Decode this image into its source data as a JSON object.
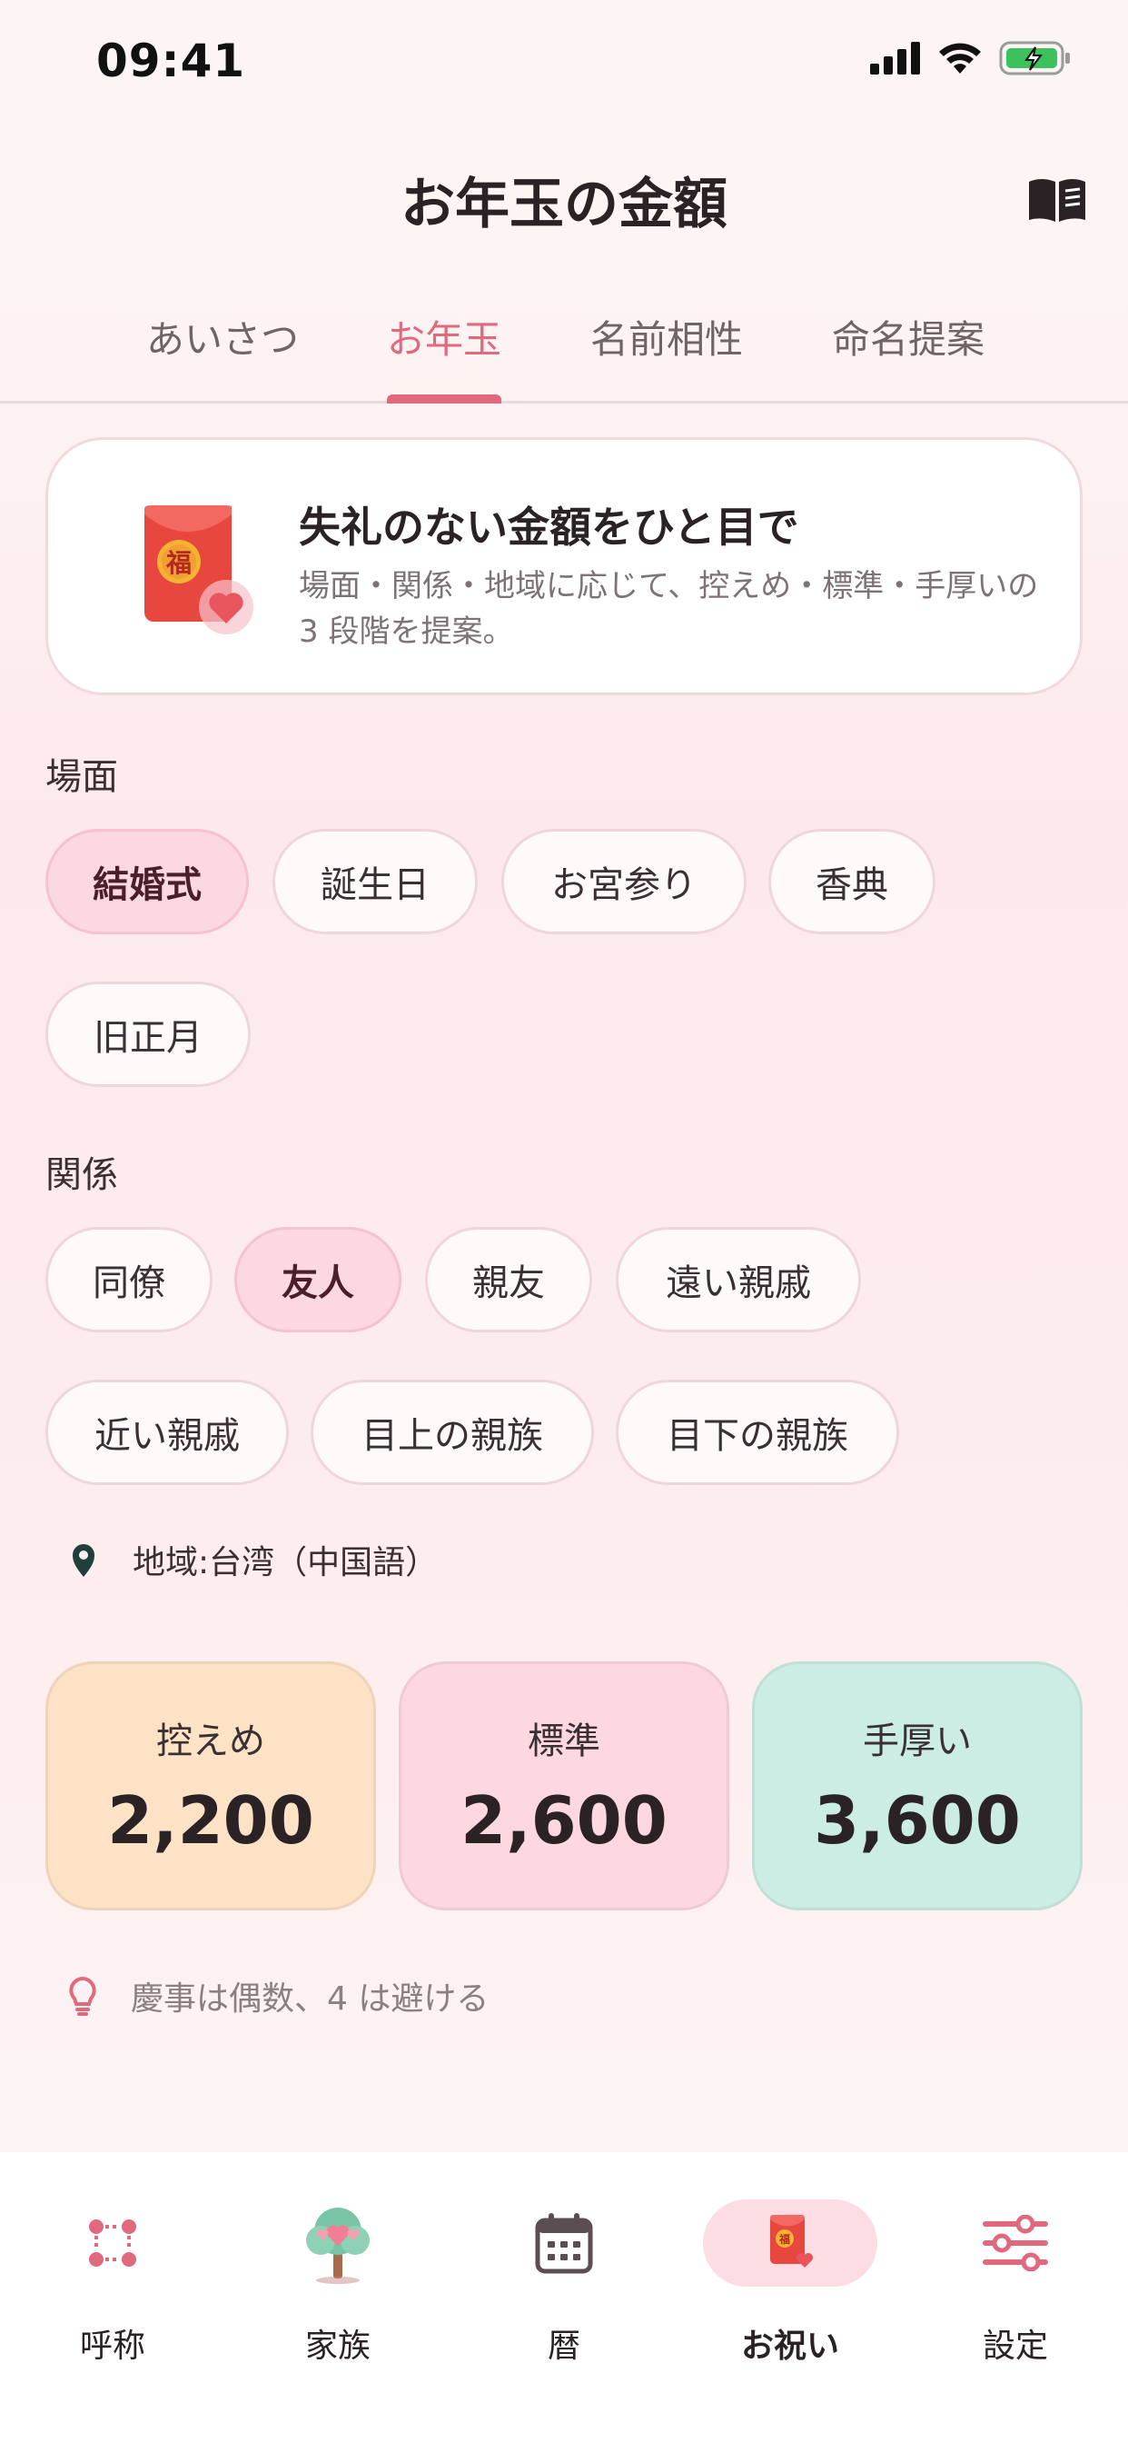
{
  "status_bar": {
    "time": "09:41"
  },
  "header": {
    "title": "お年玉の金額",
    "book_icon": "book-open-icon"
  },
  "tabs": [
    {
      "label": "あいさつ",
      "active": false
    },
    {
      "label": "お年玉",
      "active": true
    },
    {
      "label": "名前相性",
      "active": false
    },
    {
      "label": "命名提案",
      "active": false
    }
  ],
  "intro": {
    "icon": "red-envelope-icon",
    "envelope_char": "福",
    "title": "失礼のない金額をひと目で",
    "description": "場面・関係・地域に応じて、控えめ・標準・手厚いの 3 段階を提案。"
  },
  "occasion": {
    "label": "場面",
    "options": [
      "結婚式",
      "誕生日",
      "お宮参り",
      "香典",
      "旧正月"
    ],
    "selected": "結婚式"
  },
  "relation": {
    "label": "関係",
    "options": [
      "同僚",
      "友人",
      "親友",
      "遠い親戚",
      "近い親戚",
      "目上の親族",
      "目下の親族"
    ],
    "selected": "友人"
  },
  "region": {
    "icon": "location-pin-icon",
    "text": "地域:台湾（中国語）"
  },
  "amounts": [
    {
      "label": "控えめ",
      "value": "2,200",
      "color": "#fde2c6"
    },
    {
      "label": "標準",
      "value": "2,600",
      "color": "#fdd8e0"
    },
    {
      "label": "手厚い",
      "value": "3,600",
      "color": "#ccede4"
    }
  ],
  "tip": {
    "icon": "lightbulb-icon",
    "text": "慶事は偶数、4 は避ける"
  },
  "bottom_nav": [
    {
      "label": "呼称",
      "icon": "grid-dots-icon",
      "active": false
    },
    {
      "label": "家族",
      "icon": "family-tree-icon",
      "active": false
    },
    {
      "label": "暦",
      "icon": "calendar-icon",
      "active": false
    },
    {
      "label": "お祝い",
      "icon": "red-envelope-icon",
      "active": true
    },
    {
      "label": "設定",
      "icon": "sliders-icon",
      "active": false
    }
  ],
  "colors": {
    "accent": "#e0697e",
    "chip_selected": "#fcd9e0",
    "text": "#2a2224"
  }
}
